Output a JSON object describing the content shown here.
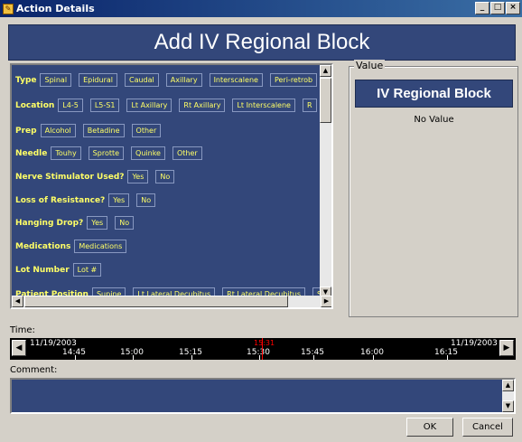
{
  "window": {
    "title": "Action Details",
    "controls": [
      "_",
      "□",
      "×"
    ]
  },
  "header": {
    "title": "Add IV Regional Block"
  },
  "rows": [
    {
      "label": "Type",
      "options": [
        "Spinal",
        "Epidural",
        "Caudal",
        "Axillary",
        "Interscalene",
        "Peri-retrob"
      ]
    },
    {
      "label": "Location",
      "options": [
        "L4-5",
        "L5-S1",
        "Lt Axillary",
        "Rt Axillary",
        "Lt Interscalene",
        "R"
      ]
    },
    {
      "label": "Prep",
      "options": [
        "Alcohol",
        "Betadine",
        "Other"
      ]
    },
    {
      "label": "Needle",
      "options": [
        "Touhy",
        "Sprotte",
        "Quinke",
        "Other"
      ]
    },
    {
      "label": "Nerve Stimulator Used?",
      "options": [
        "Yes",
        "No"
      ]
    },
    {
      "label": "Loss of Resistance?",
      "options": [
        "Yes",
        "No"
      ]
    },
    {
      "label": "Hanging Drop?",
      "options": [
        "Yes",
        "No"
      ]
    },
    {
      "label": "Medications",
      "options": [
        "Medications"
      ]
    },
    {
      "label": "Lot Number",
      "options": [
        "Lot #"
      ]
    },
    {
      "label": "Patient Position",
      "options": [
        "Supine",
        "Lt Lateral Decubitus",
        "Rt Lateral Decubitus",
        "S"
      ]
    }
  ],
  "value_panel": {
    "legend": "Value",
    "selected": "IV Regional Block",
    "empty_text": "No Value"
  },
  "timeline": {
    "label": "Time:",
    "left_date": "11/19/2003",
    "right_date": "11/19/2003",
    "ticks": [
      "14:45",
      "15:00",
      "15:15",
      "15:30",
      "15:45",
      "16:00",
      "16:15"
    ],
    "current": "15:31"
  },
  "comment": {
    "label": "Comment:",
    "value": ""
  },
  "buttons": {
    "ok": "OK",
    "cancel": "Cancel"
  }
}
